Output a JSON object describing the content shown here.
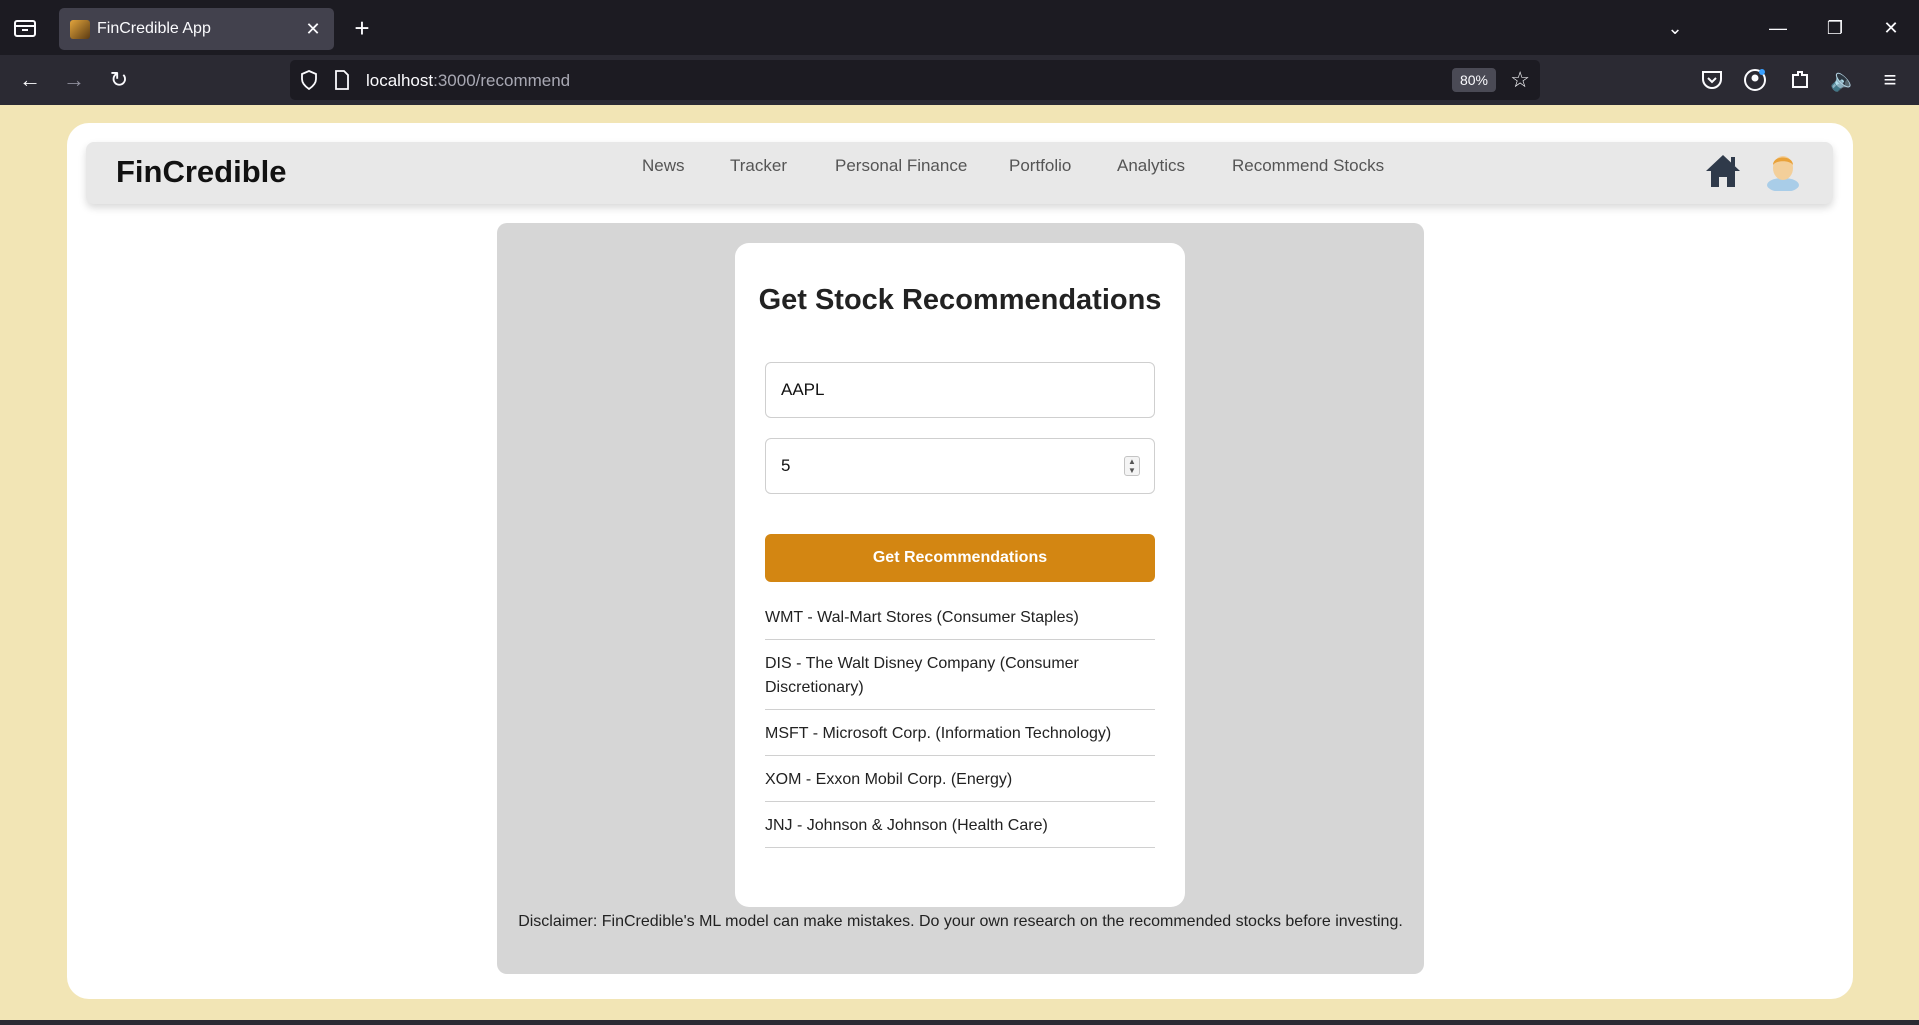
{
  "browser": {
    "tab_title": "FinCredible App",
    "url_host": "localhost",
    "url_path": ":3000/recommend",
    "zoom": "80%"
  },
  "app": {
    "brand": "FinCredible",
    "menu": [
      "News",
      "Tracker",
      "Personal Finance",
      "Portfolio",
      "Analytics",
      "Recommend Stocks"
    ]
  },
  "form": {
    "title": "Get Stock Recommendations",
    "ticker_value": "AAPL",
    "count_value": "5",
    "submit_label": "Get Recommendations"
  },
  "results": [
    "WMT - Wal-Mart Stores (Consumer Staples)",
    "DIS - The Walt Disney Company (Consumer Discretionary)",
    "MSFT - Microsoft Corp. (Information Technology)",
    "XOM - Exxon Mobil Corp. (Energy)",
    "JNJ - Johnson & Johnson (Health Care)"
  ],
  "disclaimer": "Disclaimer: FinCredible's ML model can make mistakes. Do your own research on the recommended stocks before investing.",
  "colors": {
    "accent": "#d38612",
    "page_background": "#f2e5b5",
    "panel_background": "#d6d6d6"
  }
}
